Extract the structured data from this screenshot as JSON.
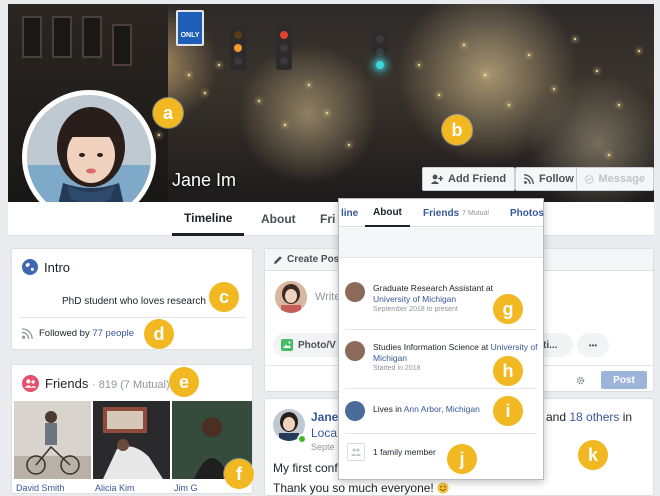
{
  "profile": {
    "name": "Jane Im",
    "actions": {
      "add_friend": "Add Friend",
      "follow": "Follow",
      "message": "Message"
    }
  },
  "cover": {
    "street_sign": "ONLY"
  },
  "tabs": {
    "timeline": "Timeline",
    "about": "About",
    "friends": "Fri"
  },
  "intro": {
    "title": "Intro",
    "bio": "PhD student who loves research",
    "followed_prefix": "Followed by ",
    "followed_link": "77 people"
  },
  "friends": {
    "title": "Friends",
    "count": "· 819 (7 Mutual)",
    "people": [
      {
        "name": "David Smith"
      },
      {
        "name": "Alicia Kim"
      },
      {
        "name": "Jim G"
      }
    ]
  },
  "composer": {
    "header": "Create Post",
    "placeholder": "Write",
    "photo_label": "Photo/V",
    "other_label": "ti...",
    "more": "•••",
    "post_button": "Post"
  },
  "feed_post": {
    "author": "Jane",
    "location": "Loca",
    "date": "Septe",
    "tail_text": "and ",
    "others_link": "18 others",
    "tail_after": " in",
    "line1": "My first conf",
    "line2": "Thank you so much everyone!"
  },
  "popup": {
    "tabs": {
      "line": "line",
      "about": "About",
      "friends": "Friends",
      "friends_mutual": "7 Mutual",
      "photos": "Photos"
    },
    "rows": [
      {
        "text": "Graduate Research Assistant at",
        "link": "University of Michigan",
        "sub": "September 2018 to present"
      },
      {
        "text": "Studies Information Science at",
        "link": "University of Michigan",
        "sub": "Started in 2018"
      },
      {
        "text": "Lives in",
        "link": "Ann Arbor, Michigan",
        "sub": ""
      },
      {
        "text": "1 family member",
        "link": "",
        "sub": ""
      }
    ]
  },
  "badges": {
    "a": "a",
    "b": "b",
    "c": "c",
    "d": "d",
    "e": "e",
    "f": "f",
    "g": "g",
    "h": "h",
    "i": "i",
    "j": "j",
    "k": "k"
  },
  "colors": {
    "badge": "#f2b822",
    "link": "#385898",
    "background": "#e9ebee"
  }
}
